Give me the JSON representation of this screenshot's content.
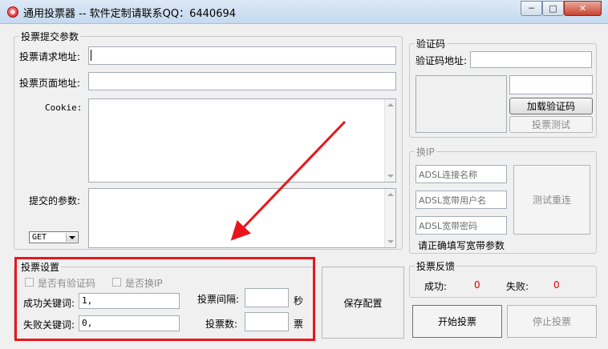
{
  "window": {
    "title": "通用投票器 -- 软件定制请联系QQ：6440694",
    "minimize_glyph": "─",
    "maximize_glyph": "□",
    "close_glyph": "✕"
  },
  "submit_params": {
    "legend": "投票提交参数",
    "request_url_label": "投票请求地址:",
    "request_url_value": "",
    "page_url_label": "投票页面地址:",
    "page_url_value": "",
    "cookie_label": "Cookie:",
    "cookie_value": "",
    "params_label": "提交的参数:",
    "params_value": "",
    "method_selected": "GET"
  },
  "captcha": {
    "legend": "验证码",
    "url_label": "验证码地址:",
    "url_value": "",
    "code_value": "",
    "load_button": "加载验证码",
    "test_vote_button": "投票测试"
  },
  "switch_ip": {
    "legend": "换IP",
    "adsl_name_placeholder": "ADSL连接名称",
    "adsl_user_placeholder": "ADSL宽带用户名",
    "adsl_password_placeholder": "ADSL宽带密码",
    "hint": "请正确填写宽带参数",
    "test_redial_button": "测试重连"
  },
  "vote_settings": {
    "legend": "投票设置",
    "has_captcha_label": "是否有验证码",
    "switch_ip_label": "是否换IP",
    "success_keyword_label": "成功关键词:",
    "success_keyword_value": "1,",
    "fail_keyword_label": "失败关键词:",
    "fail_keyword_value": "0,",
    "interval_label": "投票间隔:",
    "interval_value": "",
    "interval_unit": "秒",
    "vote_count_label": "投票数:",
    "vote_count_value": "",
    "vote_count_unit": "票",
    "save_button": "保存配置"
  },
  "feedback": {
    "legend": "投票反馈",
    "success_label": "成功:",
    "success_count": "0",
    "fail_label": "失败:",
    "fail_count": "0"
  },
  "actions": {
    "start_button": "开始投票",
    "stop_button": "停止投票"
  },
  "annotation": {
    "highlight_color": "#e8161c"
  }
}
